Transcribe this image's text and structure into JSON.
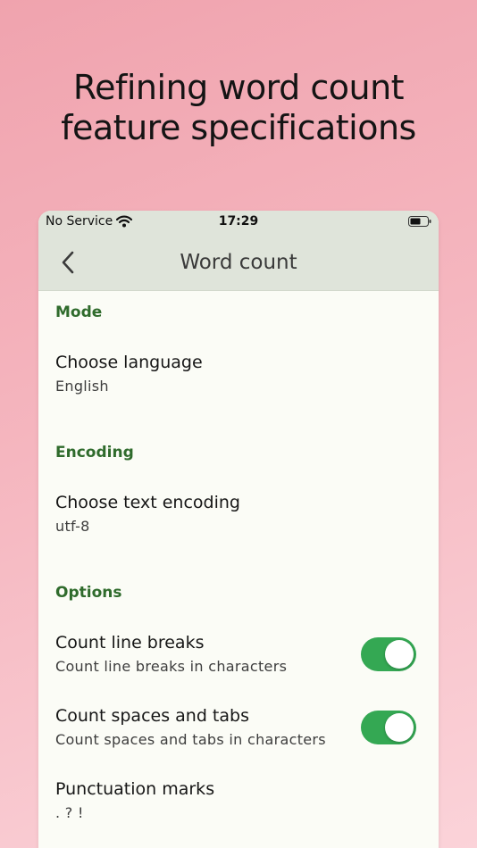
{
  "headline": {
    "line1": "Refining word count",
    "line2": "feature specifications"
  },
  "statusbar": {
    "carrier": "No Service",
    "time": "17:29",
    "wifi_icon": "wifi-icon",
    "battery_icon": "battery-icon"
  },
  "navbar": {
    "title": "Word count",
    "back_icon": "chevron-left-icon"
  },
  "sections": {
    "mode": {
      "header": "Mode",
      "choose_language": {
        "title": "Choose language",
        "value": "English"
      }
    },
    "encoding": {
      "header": "Encoding",
      "choose_encoding": {
        "title": "Choose text encoding",
        "value": "utf-8"
      }
    },
    "options": {
      "header": "Options",
      "line_breaks": {
        "title": "Count line breaks",
        "subtitle": "Count line breaks in characters",
        "enabled": true
      },
      "spaces_tabs": {
        "title": "Count spaces and tabs",
        "subtitle": "Count spaces and tabs in characters",
        "enabled": true
      },
      "punctuation": {
        "title": "Punctuation marks",
        "value": ". ? !"
      }
    }
  },
  "colors": {
    "accent_green": "#2f6b2c",
    "toggle_on": "#34a853",
    "navbar_bg": "#dfe4da"
  }
}
